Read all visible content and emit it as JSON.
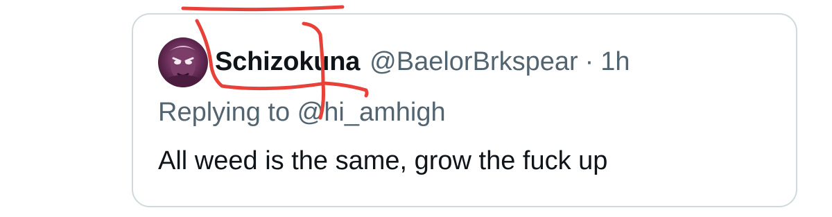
{
  "tweet": {
    "display_name": "Schizokuna",
    "handle": "@BaelorBrkspear",
    "separator": "·",
    "time": "1h",
    "replying_prefix": "Replying to ",
    "replying_to": "@hi_amhigh",
    "text": "All weed is the same, grow the fuck up"
  },
  "colors": {
    "border": "#cfd9de",
    "primary_text": "#0f1419",
    "secondary_text": "#536471",
    "annotation": "#e8413a"
  }
}
